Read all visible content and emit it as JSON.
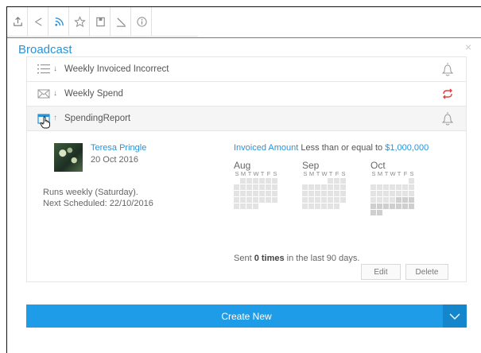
{
  "toolbar": {
    "icons": [
      "export-icon",
      "share-icon",
      "broadcast-icon",
      "favourite-icon",
      "bookmark-icon",
      "annotate-icon",
      "info-icon"
    ]
  },
  "panel": {
    "title": "Broadcast",
    "close": "×"
  },
  "broadcasts": [
    {
      "name": "Weekly Invoiced Incorrect",
      "type_icon": "list-icon",
      "status_icon": "bell-icon"
    },
    {
      "name": "Weekly Spend",
      "type_icon": "email-icon",
      "status_icon": "repeat-icon"
    },
    {
      "name": "SpendingReport",
      "type_icon": "browser-icon",
      "status_icon": "bell-icon"
    }
  ],
  "detail": {
    "user_name": "Teresa Pringle",
    "user_date": "20 Oct 2016",
    "runs_line1": "Runs weekly (Saturday).",
    "runs_line2": "Next Scheduled: 22/10/2016",
    "condition_field": "Invoiced Amount",
    "condition_op": " Less than or equal to ",
    "condition_value": "$1,000,000",
    "sent_prefix": "Sent ",
    "sent_count": "0 times",
    "sent_suffix": " in the last 90 days.",
    "edit_label": "Edit",
    "delete_label": "Delete"
  },
  "calendar": {
    "weekdays": [
      "S",
      "M",
      "T",
      "W",
      "T",
      "F",
      "S"
    ],
    "months": [
      {
        "name": "Aug"
      },
      {
        "name": "Sep"
      },
      {
        "name": "Oct"
      }
    ]
  },
  "footer": {
    "create_label": "Create New"
  },
  "colors": {
    "accent": "#2a93d5",
    "button": "#1e9ce8",
    "alert_red": "#e04040"
  }
}
